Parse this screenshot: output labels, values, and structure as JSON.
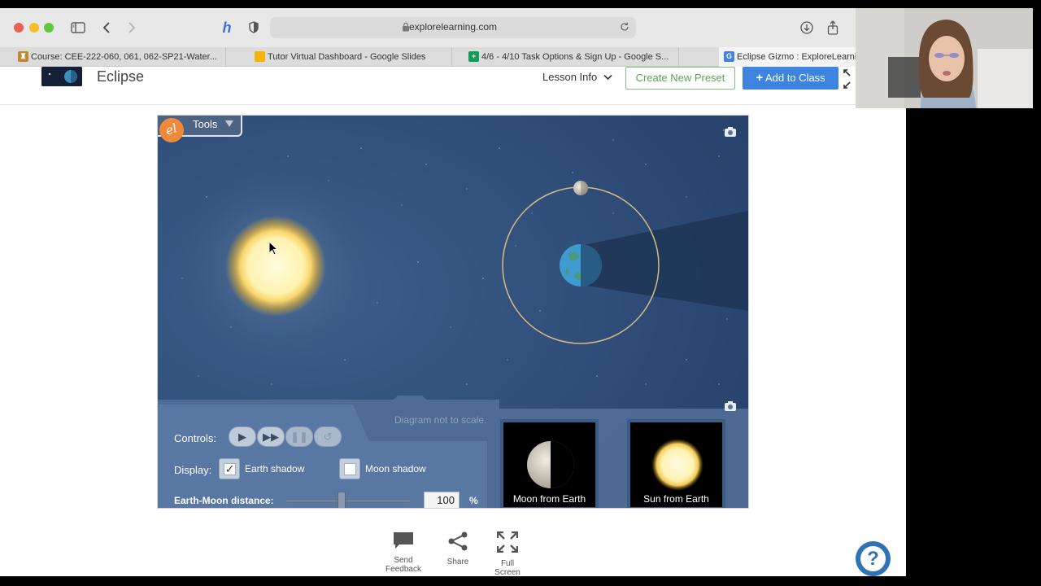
{
  "browser": {
    "url": "explorelearning.com",
    "tabs": [
      {
        "label": "Course: CEE-222-060, 061, 062-SP21-Water...",
        "favicon_color": "#c08a2c",
        "favicon_glyph": "♜"
      },
      {
        "label": "Tutor Virtual Dashboard - Google Slides",
        "favicon_color": "#f4b400",
        "favicon_glyph": ""
      },
      {
        "label": "4/6 - 4/10 Task Options & Sign Up - Google S...",
        "favicon_color": "#0f9d58",
        "favicon_glyph": "+"
      },
      {
        "label": "Eclipse Gizmo : ExploreLearning",
        "favicon_color": "#3c84e0",
        "favicon_glyph": "G"
      }
    ],
    "icons": [
      "sidebar-icon",
      "back-icon",
      "forward-icon",
      "honey-extension-icon",
      "privacy-shield-icon",
      "reload-icon",
      "download-icon",
      "share-icon"
    ]
  },
  "app": {
    "title": "Eclipse",
    "lesson_info": "Lesson Info",
    "create_preset": "Create New Preset",
    "add_to_class": "Add to Class"
  },
  "gizmo": {
    "tools_label": "Tools",
    "note": "Diagram not to scale.",
    "controls_label": "Controls:",
    "display_label": "Display:",
    "earth_shadow_label": "Earth shadow",
    "earth_shadow_checked": true,
    "moon_shadow_label": "Moon shadow",
    "moon_shadow_checked": false,
    "distance_label": "Earth-Moon distance:",
    "distance_value": "100",
    "distance_unit": "%",
    "distance_slider_fraction": 0.45,
    "moon_view_label": "Moon from Earth",
    "sun_view_label": "Sun from Earth",
    "colors": {
      "space": "#2c4a74",
      "orbit": "#d8b983",
      "sun": "#fff6c4",
      "panel": "#5a7aa3"
    }
  },
  "bottom_bar": {
    "send_feedback": "Send Feedback",
    "share": "Share",
    "full_screen": "Full Screen"
  },
  "help": {
    "label": "?"
  }
}
